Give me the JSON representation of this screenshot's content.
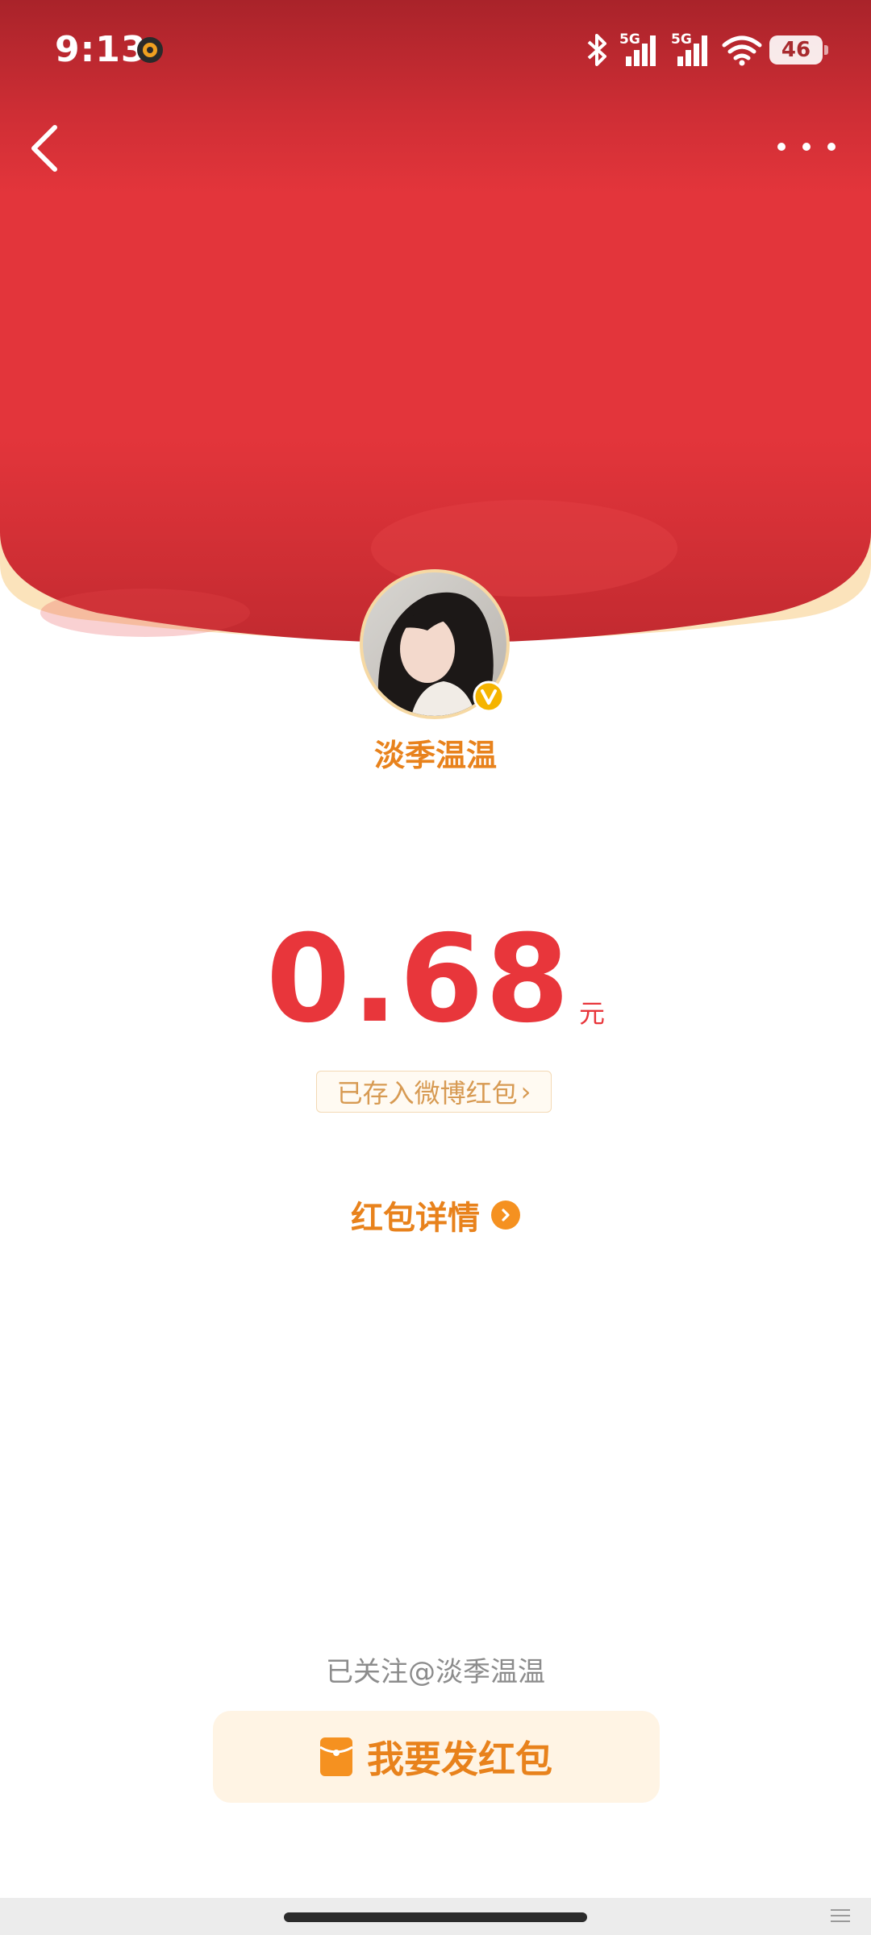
{
  "status_bar": {
    "time": "9:13",
    "network_1": "5G",
    "network_2": "5G",
    "battery": "46",
    "icons": [
      "app-notification-icon",
      "bluetooth-icon",
      "signal-icon",
      "signal-icon",
      "wifi-icon",
      "battery-icon"
    ]
  },
  "nav": {
    "back_icon": "chevron-left-icon",
    "more_icon": "more-dots-icon"
  },
  "sender": {
    "name": "淡季温温",
    "verified_mark": "V"
  },
  "amount": {
    "value": "0.68",
    "unit": "元"
  },
  "saved_link": {
    "label": "已存入微博红包",
    "chevron": "›"
  },
  "details_link": {
    "label": "红包详情"
  },
  "footer": {
    "followed_text": "已关注@淡季温温",
    "send_button_label": "我要发红包"
  },
  "colors": {
    "header_red": "#e3353b",
    "header_dark_red": "#b82a2e",
    "cream_edge": "#fbe3bb",
    "accent_orange": "#e8821c",
    "amount_red": "#e8363b"
  }
}
